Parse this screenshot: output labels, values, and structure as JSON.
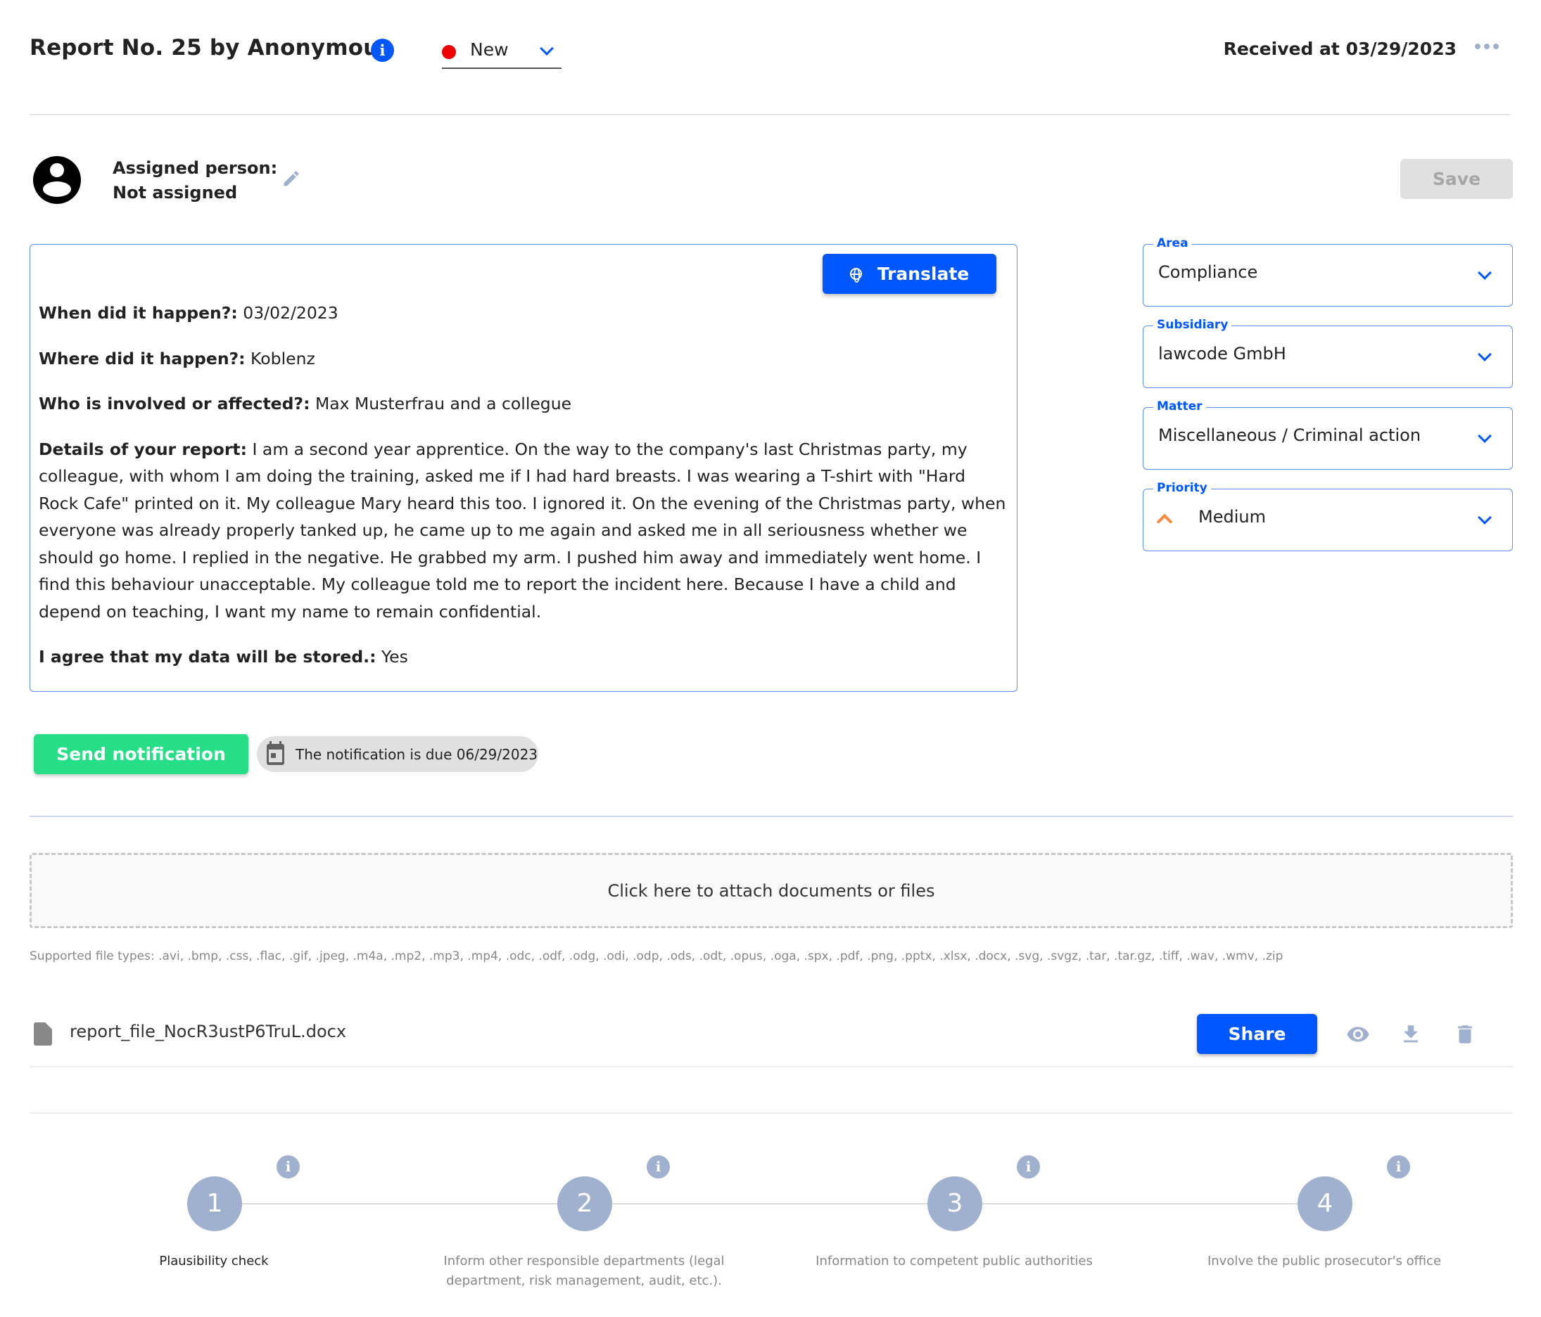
{
  "header": {
    "title": "Report No. 25 by Anonymous",
    "info_icon": "info-icon",
    "status": {
      "value": "New",
      "color": "#ee0000"
    },
    "received": "Received at 03/29/2023",
    "more_icon": "more-horizontal-icon"
  },
  "assignment": {
    "label": "Assigned person:",
    "value": "Not assigned",
    "save_label": "Save"
  },
  "report": {
    "translate_label": "Translate",
    "fields": [
      {
        "label": "When did it happen?:",
        "value": " 03/02/2023"
      },
      {
        "label": "Where did it happen?:",
        "value": " Koblenz"
      },
      {
        "label": "Who is involved or affected?:",
        "value": " Max Musterfrau and a collegue"
      },
      {
        "label": "Details of your report:",
        "value": " I am a second year apprentice. On the way to the company's last Christmas party, my colleague, with whom I am doing the training, asked me if I had hard breasts. I was wearing a T-shirt with \"Hard Rock Cafe\" printed on it. My colleague Mary heard this too. I ignored it. On the evening of the Christmas party, when everyone was already properly tanked up, he came up to me again and asked me in all seriousness whether we should go home. I replied in the negative. He grabbed my arm. I pushed him away and immediately went home. I find this behaviour unacceptable. My colleague told me to report the incident here. Because I have a child and depend on teaching, I want my name to remain confidential."
      },
      {
        "label": "I agree that my data will be stored.:",
        "value": " Yes"
      }
    ]
  },
  "classification": {
    "area": {
      "label": "Area",
      "value": "Compliance"
    },
    "subsidiary": {
      "label": "Subsidiary",
      "value": "lawcode GmbH"
    },
    "matter": {
      "label": "Matter",
      "value": "Miscellaneous / Criminal action"
    },
    "priority": {
      "label": "Priority",
      "value": "Medium",
      "color": "#ff8a3d"
    }
  },
  "notification": {
    "send_label": "Send notification",
    "due_text": "The notification is due 06/29/2023"
  },
  "attachments": {
    "dropzone_label": "Click here to attach documents or files",
    "supported_types": "Supported file types: .avi, .bmp, .css, .flac, .gif, .jpeg, .m4a, .mp2, .mp3, .mp4, .odc, .odf, .odg, .odi, .odp, .ods, .odt, .opus, .oga, .spx, .pdf, .png, .pptx, .xlsx, .docx, .svg, .svgz, .tar, .tar.gz, .tiff, .wav, .wmv, .zip",
    "files": [
      {
        "name": "report_file_NocR3ustP6TruL.docx",
        "share_label": "Share"
      }
    ]
  },
  "steps": [
    {
      "number": "1",
      "label": "Plausibility check",
      "active": true
    },
    {
      "number": "2",
      "label": "Inform other responsible departments (legal department, risk management, audit, etc.).",
      "active": false
    },
    {
      "number": "3",
      "label": "Information to competent public authorities",
      "active": false
    },
    {
      "number": "4",
      "label": "Involve the public prosecutor's office",
      "active": false
    }
  ],
  "colors": {
    "primary": "#0057ff",
    "success": "#26de86",
    "muted_icon": "#a0b0cf"
  }
}
